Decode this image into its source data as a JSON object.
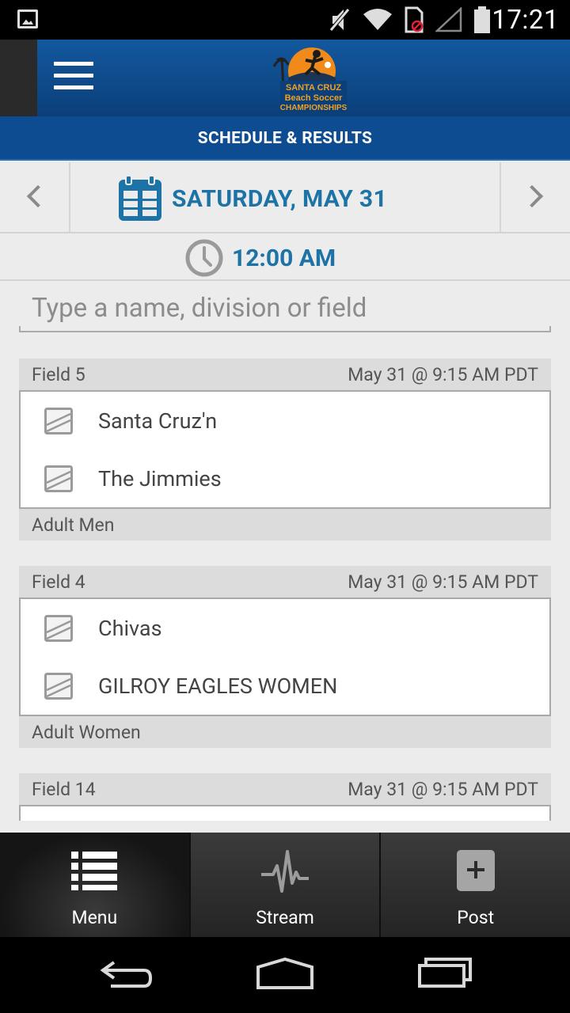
{
  "status_bar": {
    "time": "17:21",
    "icons": [
      "image-notification-icon",
      "mute-icon",
      "wifi-icon",
      "no-sim-icon",
      "signal-icon",
      "battery-icon"
    ]
  },
  "app_bar": {
    "menu_icon": "hamburger-icon",
    "logo_text": [
      "SANTA CRUZ",
      "Beach Soccer",
      "CHAMPIONSHIPS"
    ]
  },
  "section_title": "SCHEDULE & RESULTS",
  "date_nav": {
    "date": "SATURDAY, MAY 31",
    "prev_icon": "chevron-left-icon",
    "next_icon": "chevron-right-icon",
    "calendar_icon": "calendar-icon"
  },
  "time_filter": {
    "time": "12:00 AM",
    "clock_icon": "clock-icon"
  },
  "search": {
    "placeholder": "Type a name, division or field",
    "value": ""
  },
  "games": [
    {
      "field": "Field 5",
      "datetime": "May 31 @ 9:15 AM PDT",
      "teams": [
        "Santa Cruz'n",
        "The Jimmies"
      ],
      "division": "Adult Men"
    },
    {
      "field": "Field 4",
      "datetime": "May 31 @ 9:15 AM PDT",
      "teams": [
        "Chivas",
        "GILROY EAGLES WOMEN"
      ],
      "division": "Adult Women"
    },
    {
      "field": "Field 14",
      "datetime": "May 31 @ 9:15 AM PDT",
      "teams": [
        "",
        ""
      ],
      "division": ""
    }
  ],
  "tab_bar": {
    "tabs": [
      {
        "label": "Menu",
        "icon": "list-icon",
        "active": true
      },
      {
        "label": "Stream",
        "icon": "pulse-icon",
        "active": false
      },
      {
        "label": "Post",
        "icon": "plus-icon",
        "active": false
      }
    ]
  },
  "nav_bar": {
    "buttons": [
      "back-icon",
      "home-icon",
      "recents-icon"
    ]
  },
  "colors": {
    "app_bar": "#0b4a8c",
    "accent_text": "#1d72a6",
    "background": "#ececec"
  }
}
